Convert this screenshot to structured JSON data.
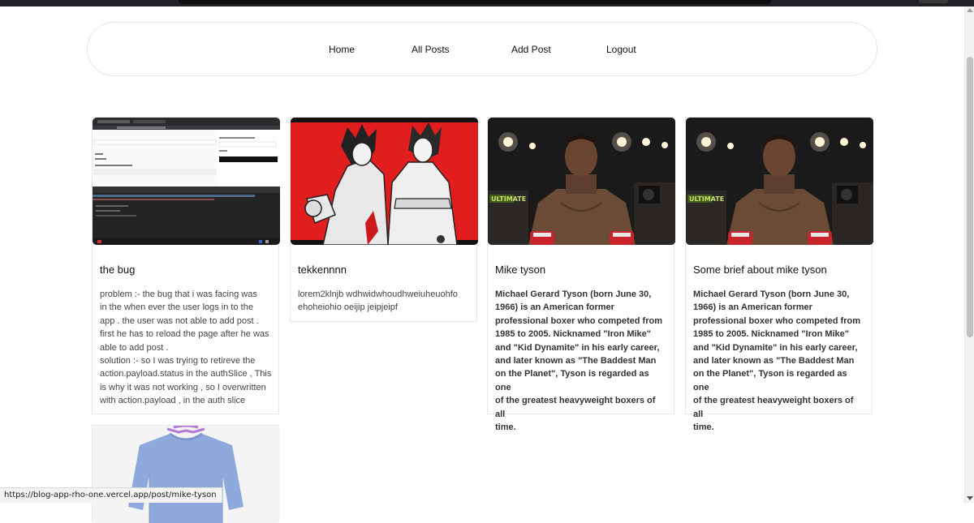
{
  "nav": {
    "items": [
      {
        "label": "Home"
      },
      {
        "label": "All Posts"
      },
      {
        "label": "Add Post"
      },
      {
        "label": "Logout"
      }
    ]
  },
  "posts": [
    {
      "title": "the bug",
      "image": "code-editor-screenshot",
      "body": "problem :- the bug that i was facing was\n in the  when ever the user logs in  to the\napp . the user was not able to add post .\nfirst he has to reload the page after he was\nable to add post .\nsolution :- so  I was trying to retireve the\naction.payload.status  in the authSlice , This\nis why it was not working , so  I overwritten\nwith action.payload , in the auth slice",
      "bold": false
    },
    {
      "title": "tekkennnn",
      "image": "tekken-artwork",
      "body": "lorem2klnjb wdhwidwhoudhweiuheuohfo\nehoheiohio oeijip jeipjeipf",
      "bold": false
    },
    {
      "title": "Mike tyson",
      "image": "boxer-photo",
      "body": "Michael Gerard Tyson (born June 30,\n1966) is an American former\nprofessional boxer who competed from\n1985 to 2005. Nicknamed \"Iron Mike\"\nand \"Kid Dynamite\" in his early career,\nand later known as \"The Baddest Man\non the Planet\", Tyson is regarded as one\nof the greatest heavyweight boxers of all\ntime.",
      "bold": true
    },
    {
      "title": "Some brief about mike tyson",
      "image": "boxer-photo",
      "body": "Michael Gerard Tyson (born June 30,\n1966) is an American former\nprofessional boxer who competed from\n1985 to 2005. Nicknamed \"Iron Mike\"\nand \"Kid Dynamite\" in his early career,\nand later known as \"The Baddest Man\non the Planet\", Tyson is regarded as one\nof the greatest heavyweight boxers of all\ntime.",
      "bold": true
    },
    {
      "title": "",
      "image": "sweatshirt-photo",
      "body": "",
      "bold": false
    }
  ],
  "status_url": "https://blog-app-rho-one.vercel.app/post/mike-tyson"
}
